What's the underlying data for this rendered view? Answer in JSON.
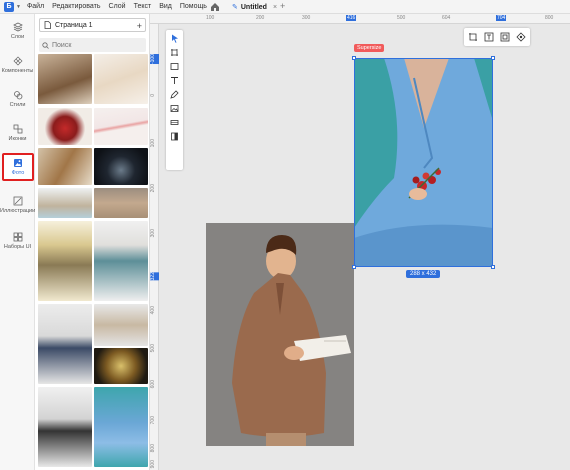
{
  "menubar": {
    "logo": "Б",
    "items": [
      "Файл",
      "Редактировать",
      "Слой",
      "Текст",
      "Вид",
      "Помощь"
    ],
    "doc_tab": "Untitled",
    "tab_close": "×",
    "new_tab": "+"
  },
  "rail": {
    "items": [
      "Слои",
      "Компоненты",
      "Стили",
      "Иконки",
      "Фото",
      "Иллюстрации",
      "Наборы UI"
    ],
    "active": "Фото",
    "accent": "#e02020"
  },
  "panel": {
    "page_name": "Страница 1",
    "add_label": "+",
    "search_placeholder": "Поиск"
  },
  "canvas": {
    "ruler_top": [
      "100",
      "200",
      "300",
      "416",
      "500",
      "604",
      "704",
      "800"
    ],
    "ruler_top_highlight": [
      "416",
      "704"
    ],
    "ruler_left": [
      "-100",
      "0",
      "100",
      "200",
      "300",
      "322",
      "400",
      "500",
      "600",
      "700",
      "800",
      "900"
    ],
    "ruler_left_highlight": [
      "-100",
      "322"
    ],
    "selected_layer_label": "Supersize",
    "selection_size": "288 x 432",
    "selection_color": "#2f6fdc"
  }
}
